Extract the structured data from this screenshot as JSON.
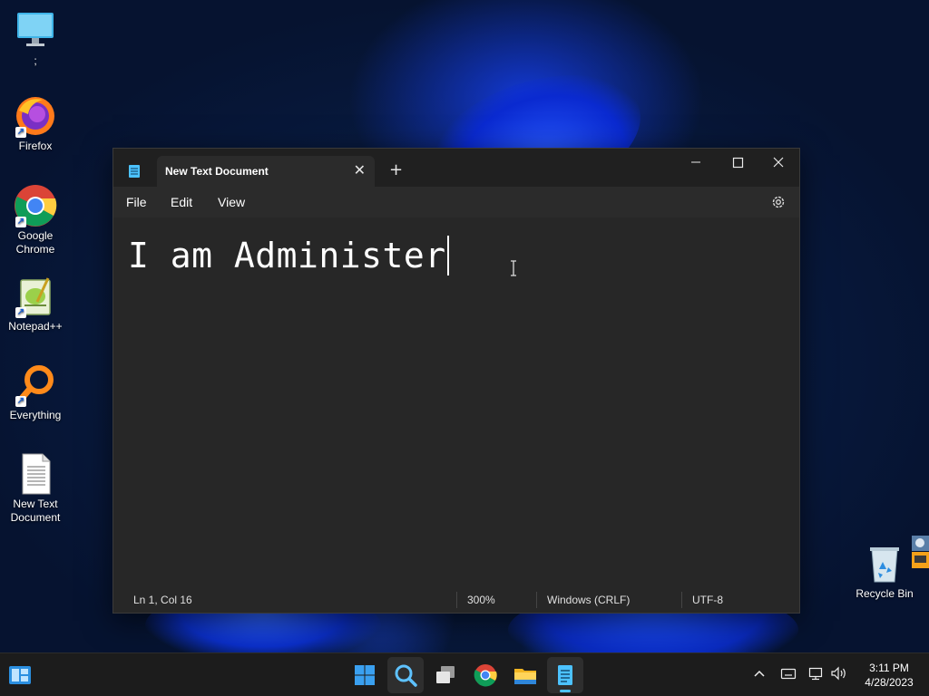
{
  "desktop": {
    "icons": [
      {
        "label": ";",
        "icon": "monitor-icon"
      },
      {
        "label": "Firefox",
        "icon": "firefox-icon"
      },
      {
        "label": "Google Chrome",
        "icon": "chrome-icon"
      },
      {
        "label": "Notepad++",
        "icon": "notepadpp-icon"
      },
      {
        "label": "Everything",
        "icon": "everything-icon"
      },
      {
        "label": "New Text Document",
        "icon": "text-document-icon"
      },
      {
        "label": "Recycle Bin",
        "icon": "recycle-bin-icon"
      }
    ]
  },
  "notepad": {
    "tab_title": "New Text Document",
    "tab_close": "✕",
    "new_tab": "+",
    "menu": {
      "file": "File",
      "edit": "Edit",
      "view": "View"
    },
    "content": "I am Administer",
    "status": {
      "position": "Ln 1, Col 16",
      "zoom": "300%",
      "line_endings": "Windows (CRLF)",
      "encoding": "UTF-8"
    }
  },
  "taskbar": {
    "apps": [
      "widgets-icon",
      "start-icon",
      "search-icon",
      "task-view-icon",
      "chrome-icon",
      "file-explorer-icon",
      "notepad-icon"
    ],
    "clock": {
      "time": "3:11 PM",
      "date": "4/28/2023"
    }
  },
  "colors": {
    "window_bg": "#202020",
    "editor_bg": "#272727",
    "accent": "#4cc2ff",
    "taskbar_bg": "#1c1c1c"
  }
}
